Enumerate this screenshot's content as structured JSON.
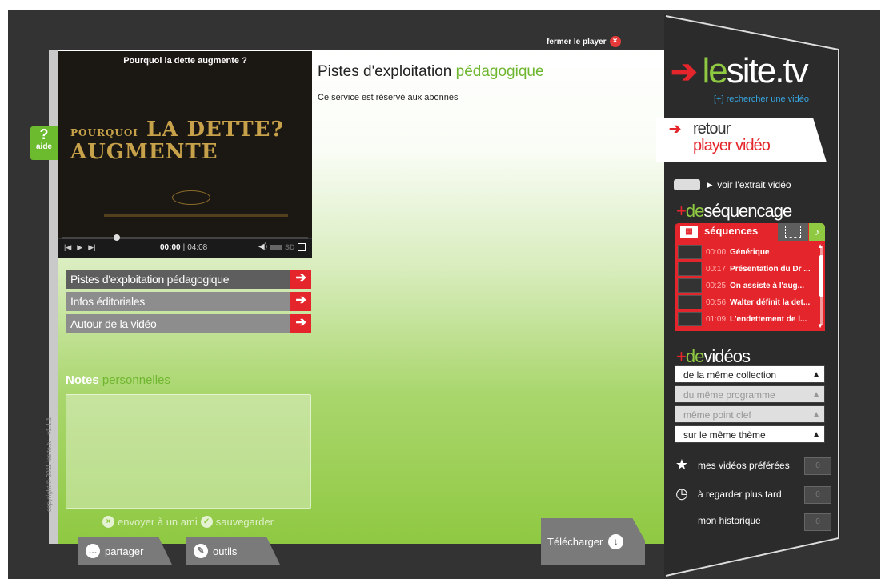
{
  "close": {
    "label": "fermer le player",
    "icon": "close-icon"
  },
  "help": {
    "symbol": "?",
    "label": "aide"
  },
  "copyright": "copyright © 2011 lesite.tv · v1.1.1",
  "video": {
    "title": "Pourquoi la dette augmente ?",
    "poster": {
      "small": "POURQUOI",
      "line1": "LA DETTE",
      "line2": "AUGMENTE",
      "mark": "?"
    },
    "time_current": "00:00",
    "time_total": "04:08",
    "hd_label": "SD",
    "progress_fraction": 0.22
  },
  "menu": [
    {
      "label": "Pistes d'exploitation pédagogique",
      "active": true
    },
    {
      "label": "Infos éditoriales",
      "active": false
    },
    {
      "label": "Autour de la vidéo",
      "active": false
    }
  ],
  "notes": {
    "title_a": "Notes",
    "title_b": "personnelles",
    "send": "envoyer à un ami",
    "save": "sauvegarder"
  },
  "content": {
    "title_a": "Pistes d'exploitation",
    "title_b": "pédagogique",
    "text": "Ce service est réservé aux abonnés"
  },
  "bottom": {
    "share": "partager",
    "tools": "outils",
    "download": "Télécharger"
  },
  "sidebar": {
    "logo_a": "le",
    "logo_b": "site.tv",
    "search": "[+] rechercher une vidéo",
    "back_l1": "retour",
    "back_l2": "player vidéo",
    "extract": "► voir l'extrait vidéo",
    "seq_plus": "+",
    "seq_de": "de",
    "seq_word": "séquencage",
    "seq_tab": "séquences",
    "sequences": [
      {
        "time": "00:00",
        "label": "Générique"
      },
      {
        "time": "00:17",
        "label": "Présentation du Dr ..."
      },
      {
        "time": "00:25",
        "label": "On assiste à l'aug..."
      },
      {
        "time": "00:56",
        "label": "Walter définit la det..."
      },
      {
        "time": "01:09",
        "label": "L'endettement de l..."
      }
    ],
    "vid_plus": "+",
    "vid_de": "de",
    "vid_word": "vidéos",
    "video_links": [
      {
        "label": "de la même collection",
        "enabled": true
      },
      {
        "label": "du même programme",
        "enabled": false
      },
      {
        "label": "même point clef",
        "enabled": false
      },
      {
        "label": "sur le même thème",
        "enabled": true
      }
    ],
    "favorites": [
      {
        "icon": "star-icon",
        "label": "mes vidéos préférées",
        "count": "0"
      },
      {
        "icon": "clock-icon",
        "label": "à regarder plus tard",
        "count": "0"
      },
      {
        "icon": "",
        "label": "mon historique",
        "count": "0"
      }
    ]
  },
  "colors": {
    "accent_red": "#e4262c",
    "accent_green": "#8fc942",
    "link_blue": "#37a6e2"
  }
}
